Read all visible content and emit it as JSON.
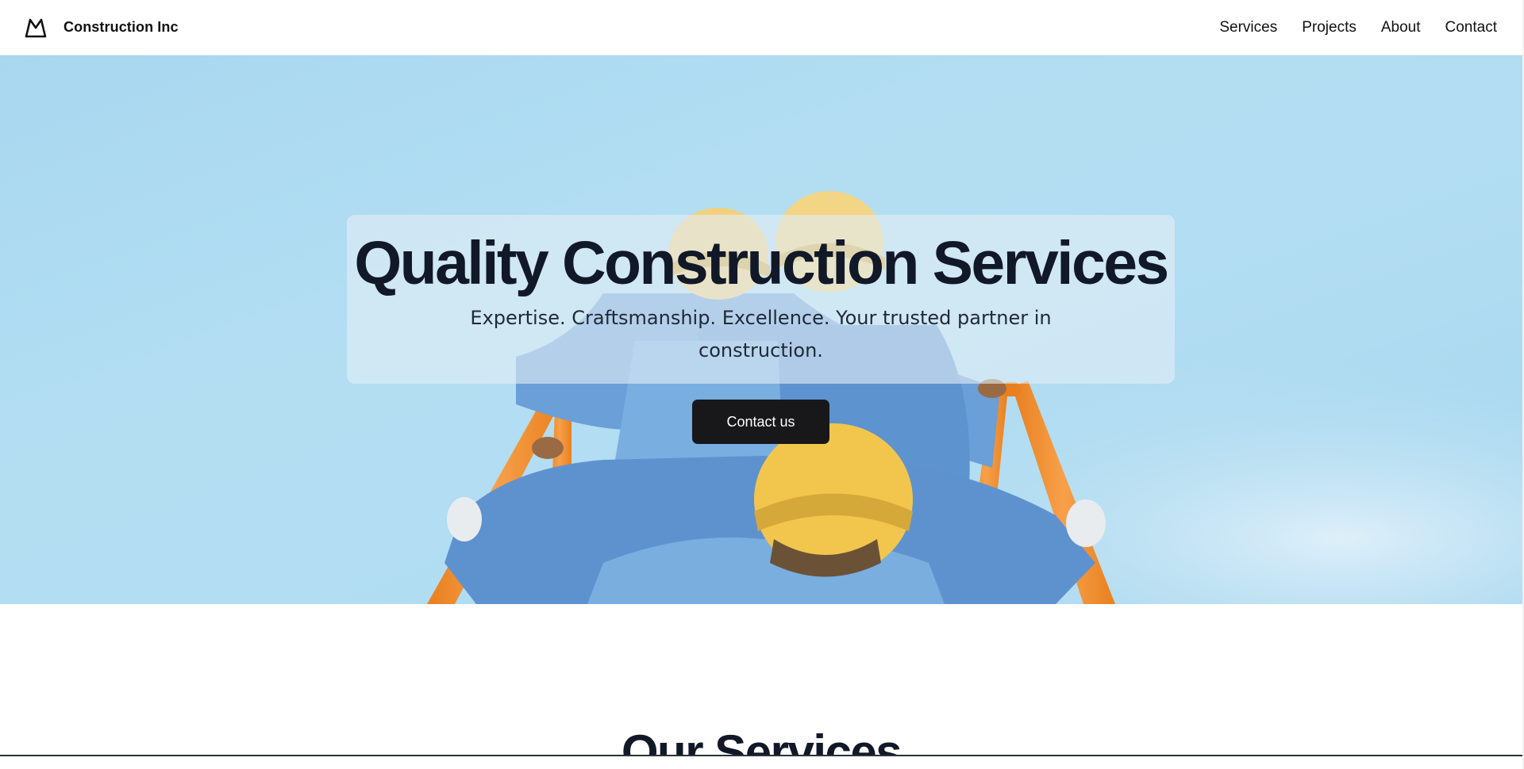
{
  "header": {
    "brand_name": "Construction Inc",
    "logo_icon": "mountain-icon",
    "nav": [
      {
        "label": "Services"
      },
      {
        "label": "Projects"
      },
      {
        "label": "About"
      },
      {
        "label": "Contact"
      }
    ]
  },
  "hero": {
    "title": "Quality Construction Services",
    "subtitle": "Expertise. Craftsmanship. Excellence. Your trusted partner in construction.",
    "cta_label": "Contact us",
    "photo_subject": "construction workers in hard hats climbing an orange ladder against a blue sky"
  },
  "services": {
    "heading": "Our Services"
  },
  "colors": {
    "text_dark": "#111827",
    "button_bg": "#18181b",
    "button_text": "#ffffff",
    "sky": "#b2ddf1",
    "ladder_orange": "#f08a2b",
    "helmet_yellow": "#f2c64d",
    "workwear_blue": "#6a9fd8"
  }
}
